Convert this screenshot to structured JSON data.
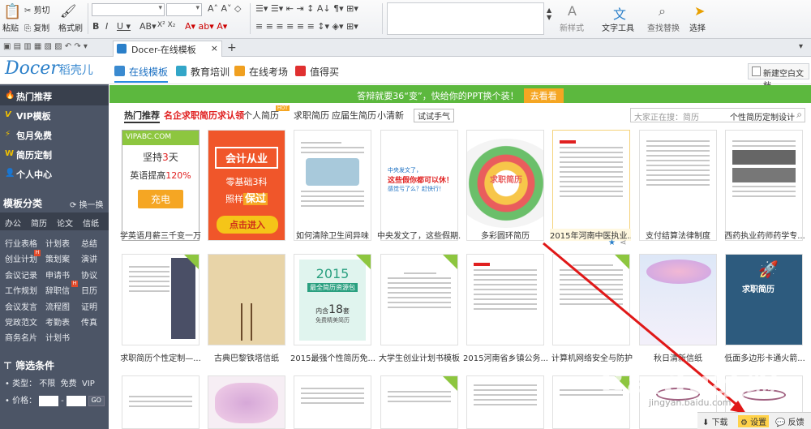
{
  "ribbon": {
    "cut": "剪切",
    "paste": "粘贴",
    "copy": "复制",
    "format_painter": "格式刷",
    "new_style": "新样式",
    "text_tools": "文字工具",
    "find_replace": "查找替换",
    "select": "选择"
  },
  "tab": {
    "title": "Docer-在线模板",
    "close": "×",
    "add": "+"
  },
  "nav": {
    "logo": "Docer",
    "logo_cn": "稻壳儿",
    "tabs": [
      "在线模板",
      "教育培训",
      "在线考场",
      "值得买"
    ],
    "new_blank": "新建空白文档"
  },
  "sidebar": {
    "items": [
      "热门推荐",
      "VIP模板",
      "包月免费",
      "简历定制",
      "个人中心"
    ],
    "cat_title": "模板分类",
    "switch": "换一换",
    "cats": [
      [
        "办公",
        "简历",
        "论文",
        "信纸"
      ],
      [
        "行业表格",
        "计划表",
        "总结"
      ],
      [
        "创业计划",
        "策划案",
        "演讲"
      ],
      [
        "会议记录",
        "申请书",
        "协议"
      ],
      [
        "工作规划",
        "辞职信",
        "日历"
      ],
      [
        "会议发言",
        "流程图",
        "证明"
      ],
      [
        "党政范文",
        "考勤表",
        "传真"
      ],
      [
        "商务名片",
        "计划书"
      ]
    ],
    "filter_title": "筛选条件",
    "type_label": "• 类型：",
    "type_opts": [
      "不限",
      "免费",
      "VIP"
    ],
    "price_label": "• 价格：",
    "price_unit": "¥",
    "go": "GO"
  },
  "banner": {
    "text": "答辩就要36“变”，快给你的PPT换个装！",
    "btn": "去看看"
  },
  "catrow": {
    "items": [
      "热门推荐",
      "名企求职简历求认领",
      "个人简历",
      "求职简历",
      "应届生简历",
      "小清新"
    ],
    "hot": "HOT",
    "btn": "试试手气"
  },
  "search": {
    "placeholder": "大家正在搜：简历",
    "value": "个性简历定制设计"
  },
  "cards_row1": [
    "学英语月薪三千变一万",
    "",
    "如何清除卫生间异味",
    "中央发文了，这些假期...",
    "多彩圆环简历",
    "2015年河南中医执业...",
    "支付结算法律制度",
    "西药执业药师药学专..."
  ],
  "cards_row2": [
    "求职简历个性定制—...",
    "古典巴黎铁塔信纸",
    "2015最强个性简历免...",
    "大学生创业计划书模板",
    "2015河南省乡镇公务...",
    "计算机网络安全与防护",
    "秋日清新信纸",
    "低面多边形卡通火箭..."
  ],
  "ad1": {
    "brand": "VIPABC.COM",
    "l1": "坚持",
    "n1": "3",
    "d": "天",
    "l2": "英语提高",
    "pct": "120%",
    "btn": "充电"
  },
  "ad2": {
    "t1": "会计从业",
    "t2": "零基础3科",
    "t3": "照样",
    "t4": "保过",
    "btn": "点击进入"
  },
  "thumb": {
    "msg1": "中央发文了，",
    "msg2": "这些假你都可以休！",
    "msg3": "感觉亏了么？赶快行！",
    "ring": "求职简历",
    "resume2015": "2015",
    "resume2015b": "最全简历资源包",
    "inner": "内含",
    "count": "18",
    "unit": "套",
    "free": "免费精美简历",
    "rocket": "求职简历"
  },
  "bottom": {
    "download": "下载",
    "settings": "设置",
    "feedback": "反馈"
  },
  "watermark": {
    "main": "Baidu经验",
    "sub": "jingyan.baidu.com"
  },
  "colors": {
    "accent": "#2a8ae0",
    "banner": "#5cb83e",
    "sidebar": "#4c5566",
    "red": "#e02020"
  }
}
